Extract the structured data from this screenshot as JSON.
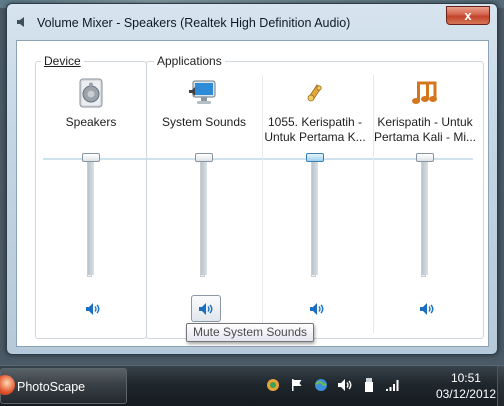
{
  "window": {
    "title": "Volume Mixer - Speakers (Realtek High Definition Audio)",
    "close_glyph": "x"
  },
  "device_group": {
    "label": "Device",
    "channel": {
      "name": "Speakers",
      "icon": "speaker-device-icon",
      "volume_fraction": 1.0,
      "muted": false
    }
  },
  "apps_group": {
    "label": "Applications",
    "channels": [
      {
        "name": "System Sounds",
        "icon": "system-sounds-icon",
        "volume_fraction": 1.0,
        "muted": false,
        "focused": true
      },
      {
        "name": "1055. Kerispatih -\nUntuk Pertama K...",
        "icon": "media-player-icon",
        "volume_fraction": 1.0,
        "muted": false,
        "active_thumb": true
      },
      {
        "name": "Kerispatih - Untuk\nPertama Kali - Mi...",
        "icon": "music-notes-icon",
        "volume_fraction": 1.0,
        "muted": false
      }
    ]
  },
  "tooltip": {
    "text": "Mute System Sounds"
  },
  "taskbar": {
    "app_button_label": "PhotoScape",
    "tray_icons": [
      "photoscape-tray-icon",
      "action-center-flag-icon",
      "network-globe-icon",
      "volume-tray-icon",
      "usb-device-icon",
      "signal-bars-icon"
    ],
    "clock_time": "10:51",
    "clock_date": "03/12/2012"
  },
  "colors": {
    "accent_blue": "#1b6fc0",
    "active_thumb": "#9fd1f0",
    "title_glass": "#c4d5e4",
    "taskbar": "#1f272d"
  }
}
